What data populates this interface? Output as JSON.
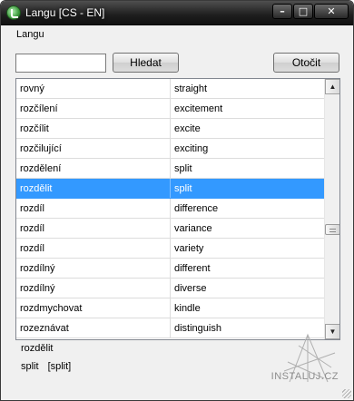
{
  "window": {
    "title": "Langu [CS - EN]"
  },
  "menu": {
    "items": [
      "Langu"
    ]
  },
  "search": {
    "value": "",
    "placeholder": ""
  },
  "buttons": {
    "search_label": "Hledat",
    "flip_label": "Otočit"
  },
  "table": {
    "selected_index": 5,
    "rows": [
      {
        "cs": "rovný",
        "en": "straight"
      },
      {
        "cs": "rozčílení",
        "en": "excitement"
      },
      {
        "cs": "rozčílit",
        "en": "excite"
      },
      {
        "cs": "rozčilující",
        "en": "exciting"
      },
      {
        "cs": "rozdělení",
        "en": "split"
      },
      {
        "cs": "rozdělit",
        "en": "split"
      },
      {
        "cs": "rozdíl",
        "en": "difference"
      },
      {
        "cs": "rozdíl",
        "en": "variance"
      },
      {
        "cs": "rozdíl",
        "en": "variety"
      },
      {
        "cs": "rozdílný",
        "en": "different"
      },
      {
        "cs": "rozdílný",
        "en": "diverse"
      },
      {
        "cs": "rozdmychovat",
        "en": "kindle"
      },
      {
        "cs": "rozeznávat",
        "en": "distinguish"
      }
    ]
  },
  "detail": {
    "word": "rozdělit",
    "translation": "split",
    "translation_bracket": "[split]"
  },
  "watermark": {
    "text": "INSTALUJ.CZ"
  },
  "colors": {
    "selection": "#3399ff",
    "titlebar": "#1e1e1e"
  },
  "icons": [
    "app-icon",
    "minimize-icon",
    "maximize-icon",
    "close-icon",
    "scroll-up-icon",
    "scroll-down-icon"
  ]
}
